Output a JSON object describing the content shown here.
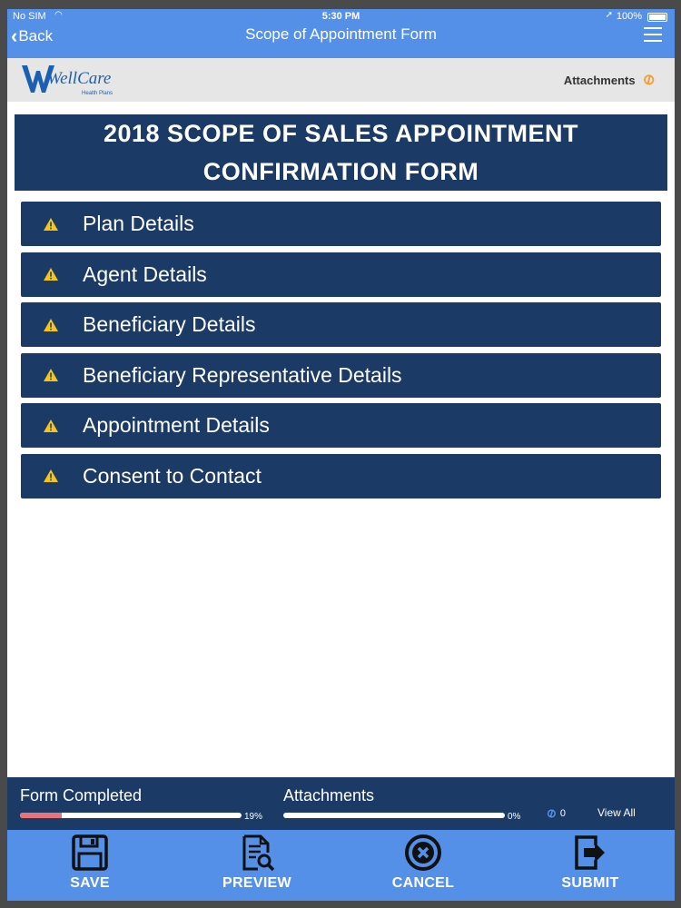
{
  "status_bar": {
    "carrier": "No SIM",
    "time": "5:30 PM",
    "battery": "100%"
  },
  "nav": {
    "back_label": "Back",
    "title": "Scope of Appointment Form"
  },
  "header": {
    "logo_text": "WellCare",
    "logo_subtext": "Health Plans",
    "attachments_label": "Attachments"
  },
  "form": {
    "title_line1": "2018 SCOPE OF SALES APPOINTMENT",
    "title_line2": "CONFIRMATION FORM",
    "sections": [
      {
        "label": "Plan Details",
        "icon": "warning-icon"
      },
      {
        "label": "Agent Details",
        "icon": "warning-icon"
      },
      {
        "label": "Beneficiary Details",
        "icon": "warning-icon"
      },
      {
        "label": "Beneficiary Representative Details",
        "icon": "warning-icon"
      },
      {
        "label": "Appointment Details",
        "icon": "warning-icon"
      },
      {
        "label": "Consent to Contact",
        "icon": "warning-icon"
      }
    ]
  },
  "progress": {
    "form_completed_label": "Form Completed",
    "form_completed_pct": "19%",
    "form_completed_value": 0.19,
    "attachments_label": "Attachments",
    "attachments_pct": "0%",
    "attachments_value": 0,
    "attachment_count": "0",
    "view_all_label": "View All"
  },
  "actions": {
    "save": "SAVE",
    "preview": "PREVIEW",
    "cancel": "CANCEL",
    "submit": "SUBMIT"
  },
  "colors": {
    "nav_blue": "#5590e8",
    "dark_navy": "#1b3a66",
    "warning_yellow": "#f5c518",
    "progress_fill": "#e8737a",
    "attachment_orange": "#f0a030"
  }
}
